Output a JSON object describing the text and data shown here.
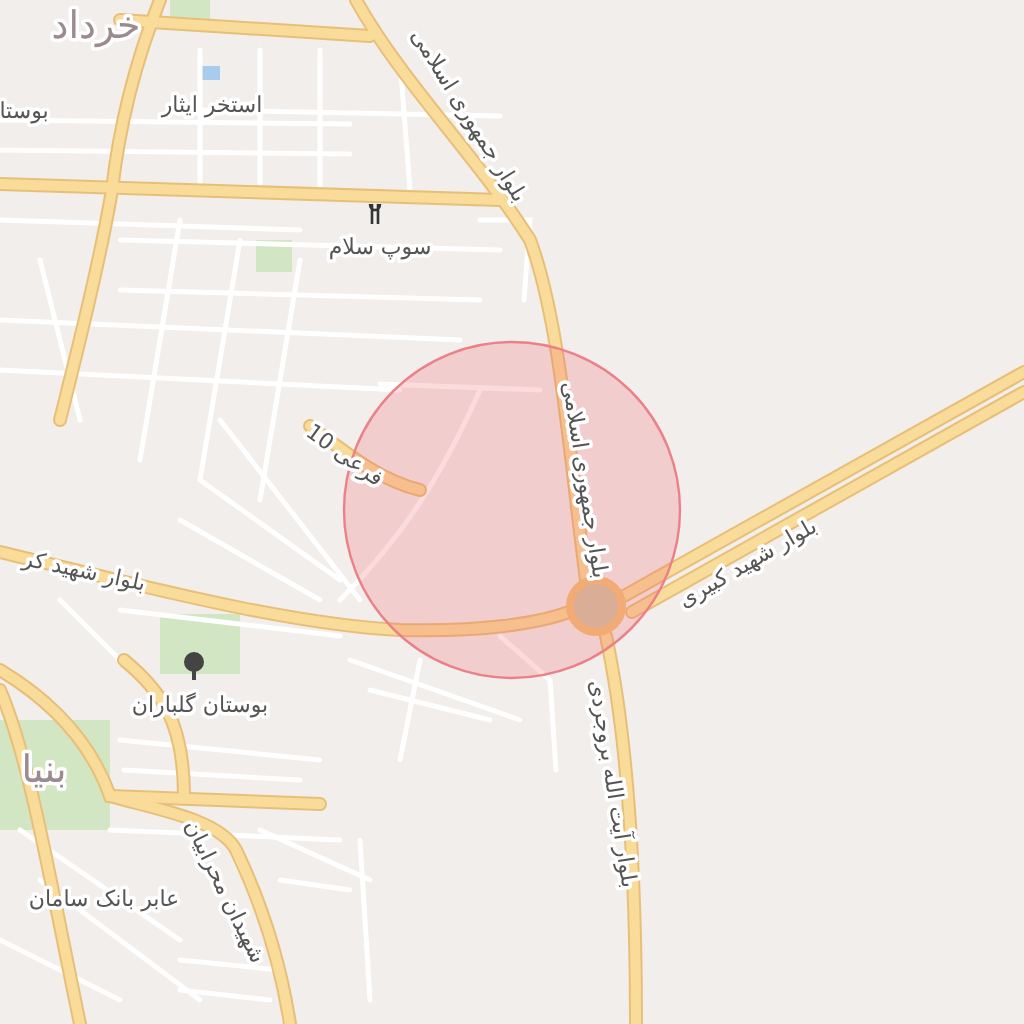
{
  "map": {
    "labels": [
      {
        "text": "خرداد",
        "kind": "district"
      },
      {
        "text": "بوستا",
        "kind": "place"
      },
      {
        "text": "استخر ایثار",
        "kind": "place"
      },
      {
        "text": "بلوار جمهوری اسلامی",
        "kind": "street"
      },
      {
        "text": "سوپ سلام",
        "kind": "place"
      },
      {
        "text": "فرعی 10",
        "kind": "street"
      },
      {
        "text": "بلوار جمهوری اسلامی",
        "kind": "street"
      },
      {
        "text": "بلوار شهید کبیری",
        "kind": "street"
      },
      {
        "text": "بلوار شهید کر",
        "kind": "street"
      },
      {
        "text": "بوستان گلباران",
        "kind": "place"
      },
      {
        "text": "بنیا",
        "kind": "district"
      },
      {
        "text": "شهیدان محرابیان",
        "kind": "street"
      },
      {
        "text": "عابر بانک سامان",
        "kind": "place"
      },
      {
        "text": "بلوار آیت الله بروجردی",
        "kind": "street"
      }
    ]
  }
}
